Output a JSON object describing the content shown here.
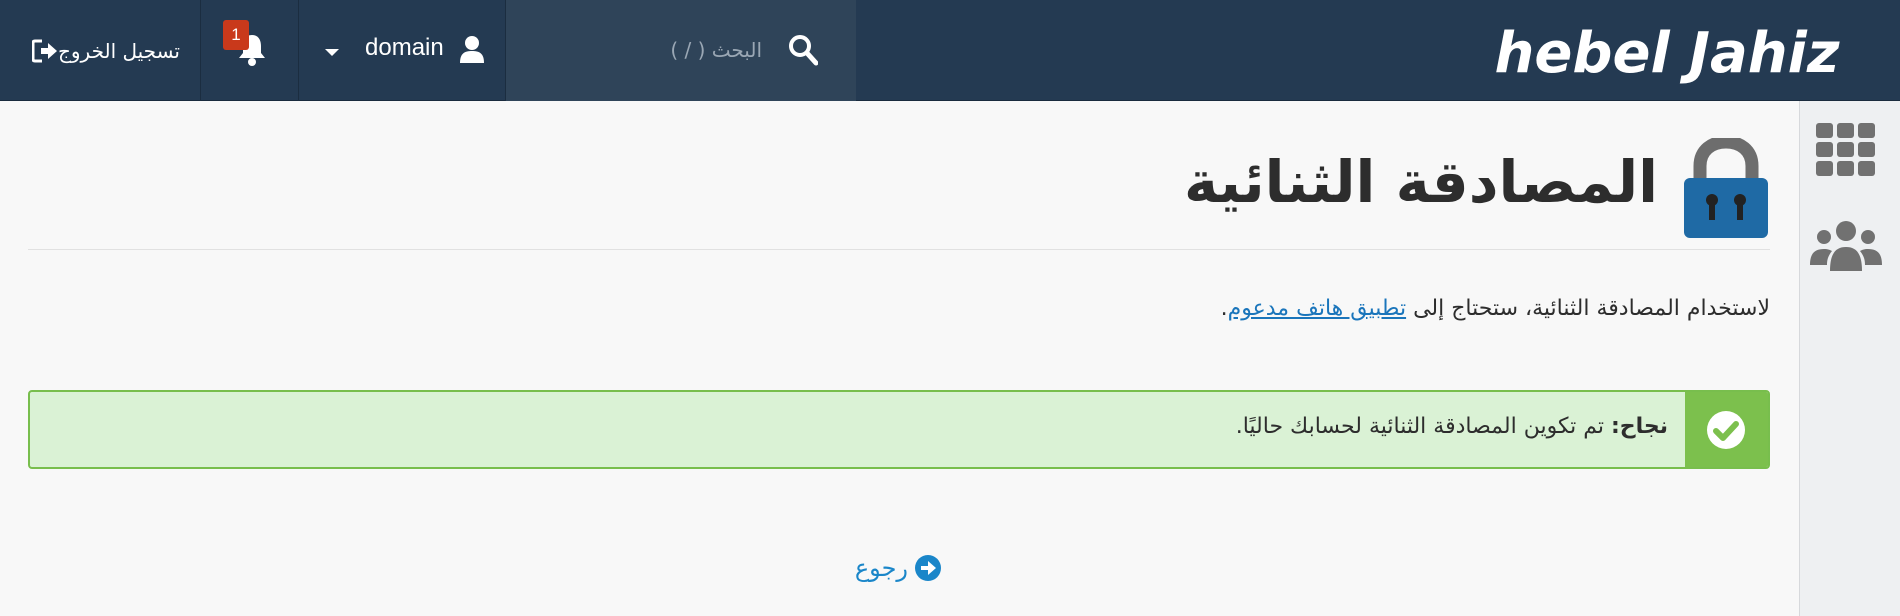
{
  "header": {
    "brand": "hebel Jahiz",
    "search_placeholder": "البحث ( / )",
    "user_name": "domain",
    "notifications_count": "1",
    "logout_label": "تسجيل الخروج"
  },
  "page": {
    "title": "المصادقة الثنائية",
    "description_prefix": "لاستخدام المصادقة الثنائية، ستحتاج إلى ",
    "description_link": "تطبيق هاتف مدعوم",
    "description_suffix": "."
  },
  "alert": {
    "label": "نجاح:",
    "message": " تم تكوين المصادقة الثنائية لحسابك حاليًا."
  },
  "back_label": "رجوع",
  "colors": {
    "topbar": "#243a52",
    "accent": "#1a75bb",
    "success": "#7cc04d",
    "success_bg": "#daf2d5",
    "badge": "#c9391b"
  },
  "icons": {
    "search": "search-icon",
    "user": "user-icon",
    "bell": "bell-icon",
    "logout": "sign-out-icon",
    "apps": "grid-icon",
    "users": "people-icon",
    "lock": "lock-icon",
    "check": "check-circle-icon",
    "back": "arrow-circle-right-icon"
  }
}
